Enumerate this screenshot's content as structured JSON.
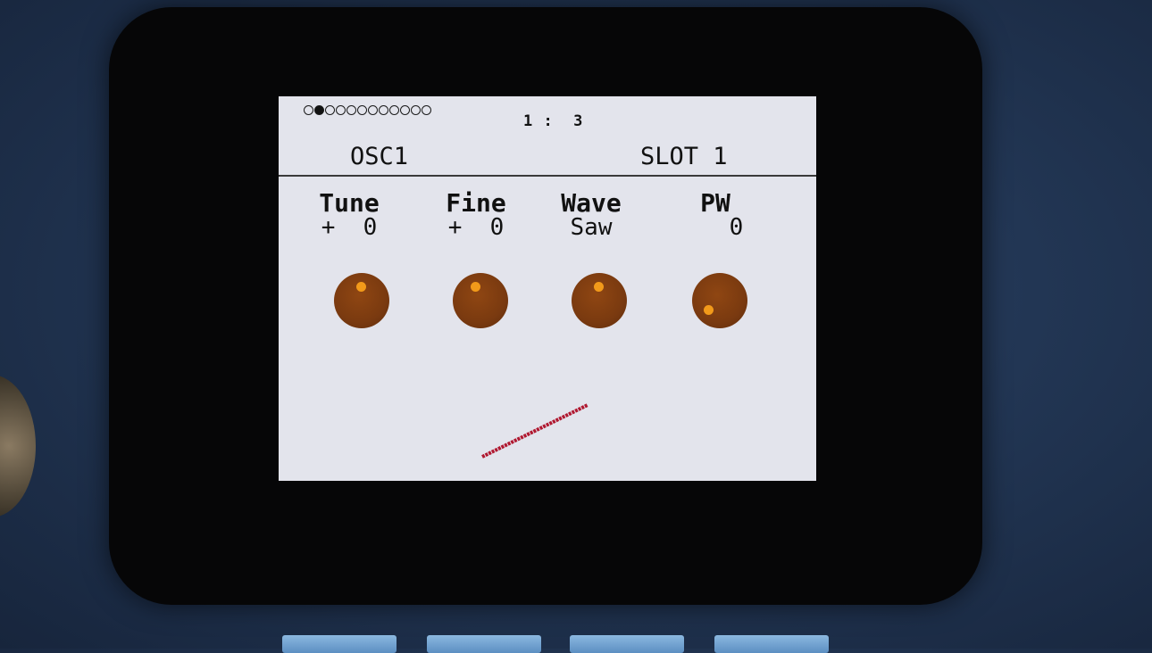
{
  "pages": {
    "total": 12,
    "active_index": 1
  },
  "page_number": "1 :  3",
  "header": {
    "osc": "OSC1",
    "slot": "SLOT 1"
  },
  "params": [
    {
      "name": "Tune",
      "value": "+  0",
      "knob_angle_deg": 0
    },
    {
      "name": "Fine",
      "value": "+  0",
      "knob_angle_deg": -20
    },
    {
      "name": "Wave",
      "value": "Saw",
      "knob_angle_deg": 0
    },
    {
      "name": "PW",
      "value": "   0",
      "knob_angle_deg": 225
    }
  ],
  "colors": {
    "screen_bg": "#e3e4ec",
    "knob": "#7a3a10",
    "knob_indicator": "#f29a1a",
    "waveform": "#b01830"
  }
}
